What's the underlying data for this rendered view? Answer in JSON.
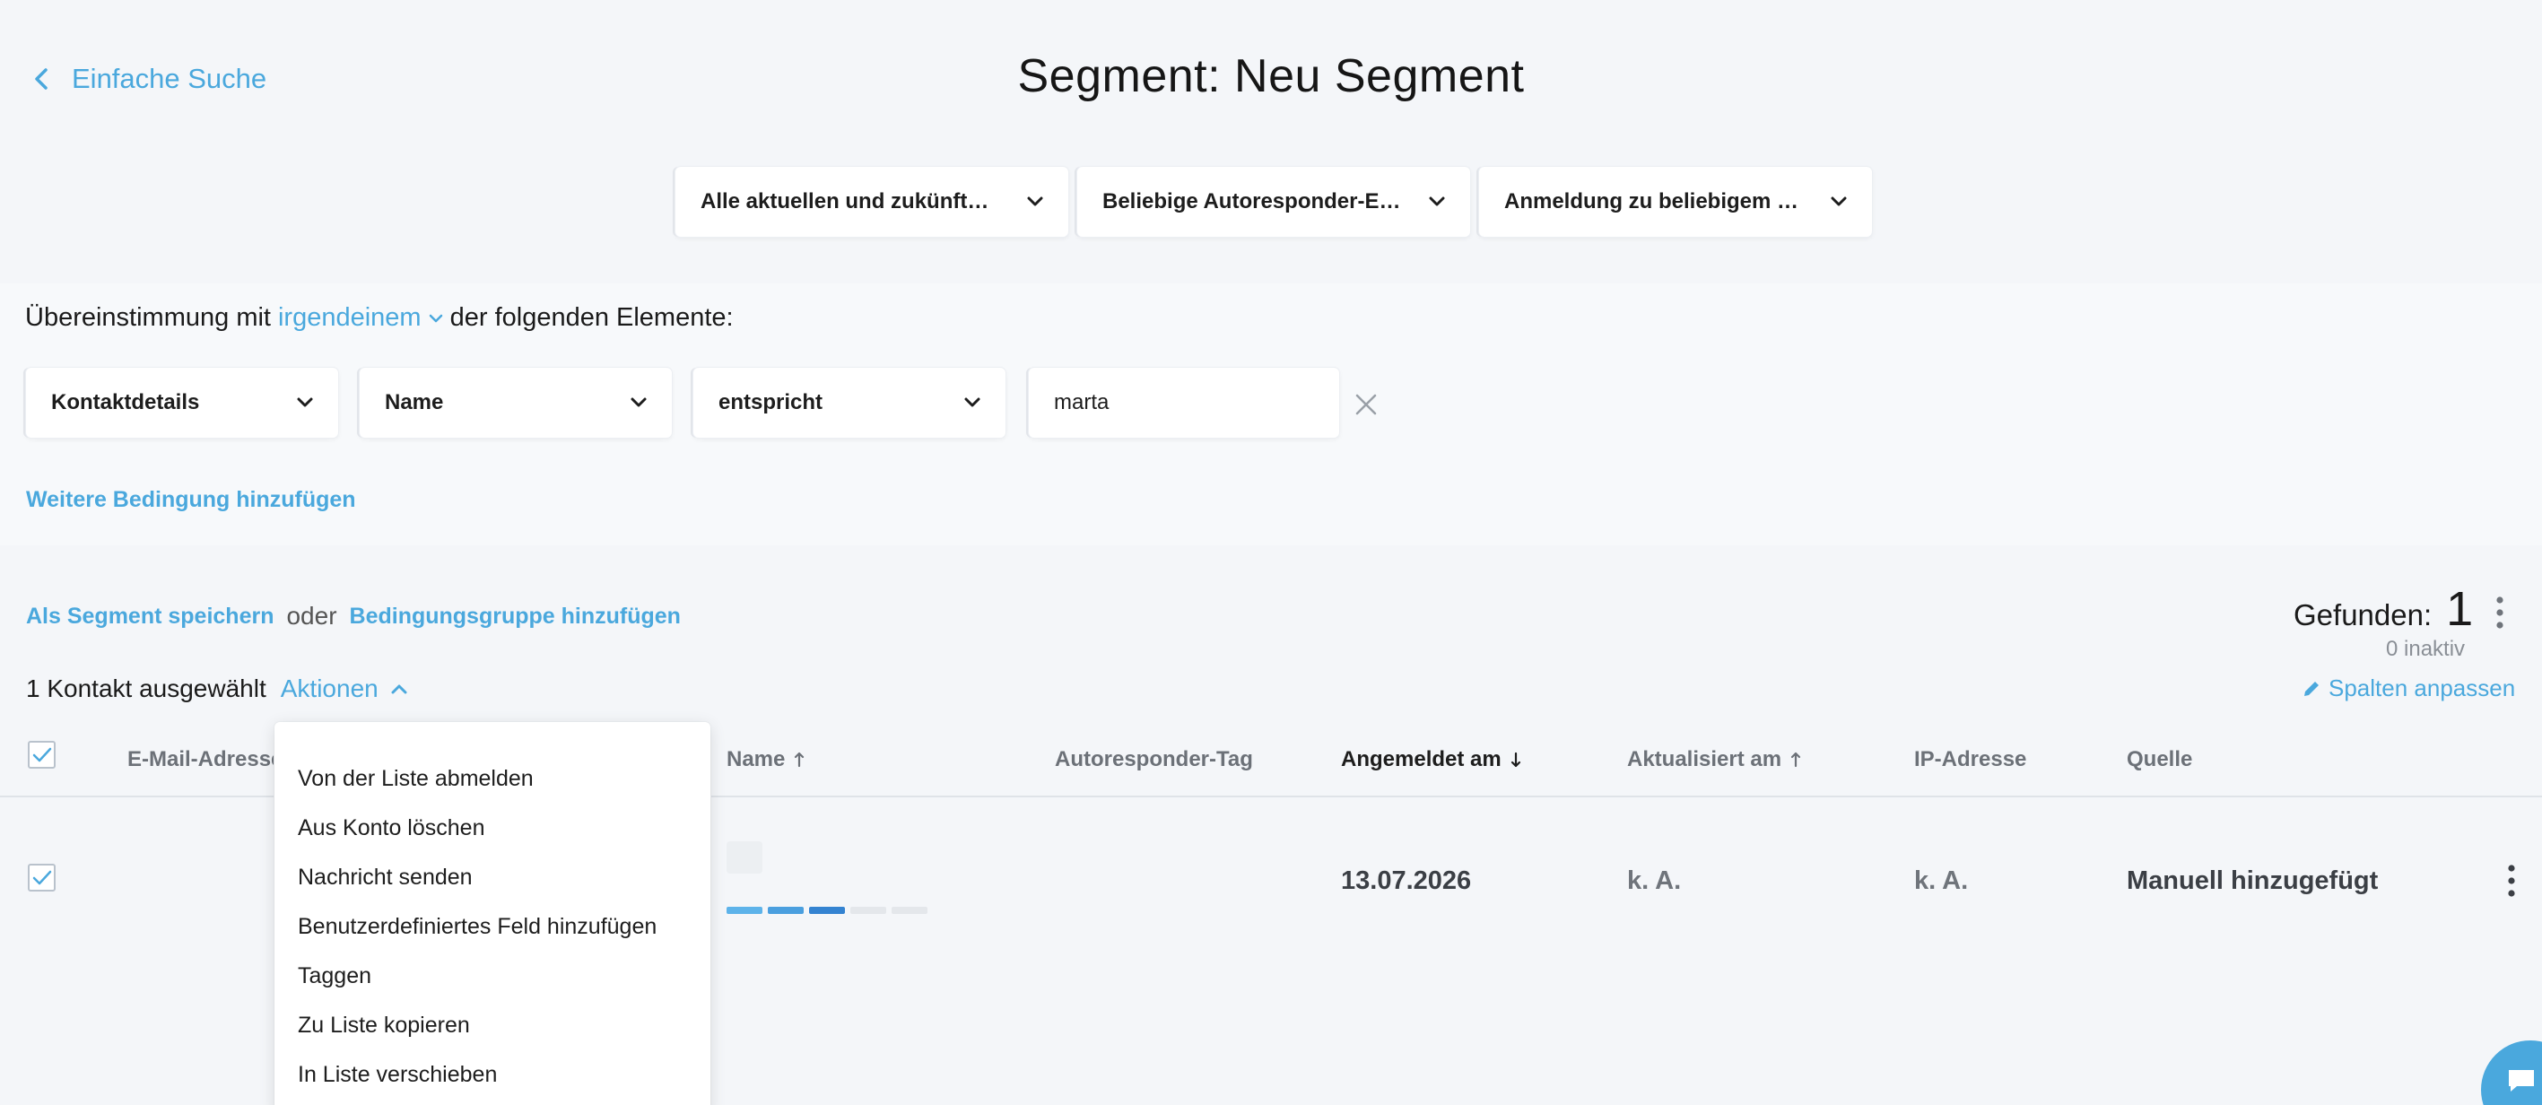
{
  "header": {
    "back_label": "Einfache Suche",
    "title": "Segment: Neu Segment"
  },
  "top_filters": [
    {
      "label": "Alle aktuellen und zukünft…"
    },
    {
      "label": "Beliebige Autoresponder-E…"
    },
    {
      "label": "Anmeldung zu beliebigem …"
    }
  ],
  "match": {
    "prefix": "Übereinstimmung mit",
    "mode": "irgendeinem",
    "suffix": "der folgenden Elemente:"
  },
  "condition": {
    "category": "Kontaktdetails",
    "field": "Name",
    "operator": "entspricht",
    "value": "marta"
  },
  "add_condition_label": "Weitere Bedingung hinzufügen",
  "actions_bar": {
    "save_label": "Als Segment speichern",
    "or_label": "oder",
    "add_group_label": "Bedingungsgruppe hinzufügen",
    "selected_label": "1 Kontakt ausgewählt",
    "actions_label": "Aktionen",
    "found_label": "Gefunden:",
    "found_count": "1",
    "inactive_label": "0 inaktiv",
    "columns_label": "Spalten anpassen"
  },
  "table": {
    "headers": {
      "email": "E-Mail-Adresse",
      "name": "Name",
      "autoresponder": "Autoresponder-Tag",
      "subscribed": "Angemeldet am",
      "updated": "Aktualisiert am",
      "ip": "IP-Adresse",
      "source": "Quelle"
    },
    "rows": [
      {
        "subscribed": "13.07.2026",
        "updated": "k. A.",
        "ip": "k. A.",
        "source": "Manuell hinzugefügt"
      }
    ]
  },
  "actions_menu": [
    "Von der Liste abmelden",
    "Aus Konto löschen",
    "Nachricht senden",
    "Benutzerdefiniertes Feld hinzufügen",
    "Taggen",
    "Zu Liste kopieren",
    "In Liste verschieben"
  ],
  "colors": {
    "accent": "#4aa8dd",
    "background": "#f4f6f9"
  },
  "icons": {
    "back": "chevron-left-icon",
    "dropdown": "chevron-down-icon",
    "close": "close-icon",
    "more": "kebab-icon",
    "edit": "pencil-icon",
    "chat": "chat-icon"
  }
}
